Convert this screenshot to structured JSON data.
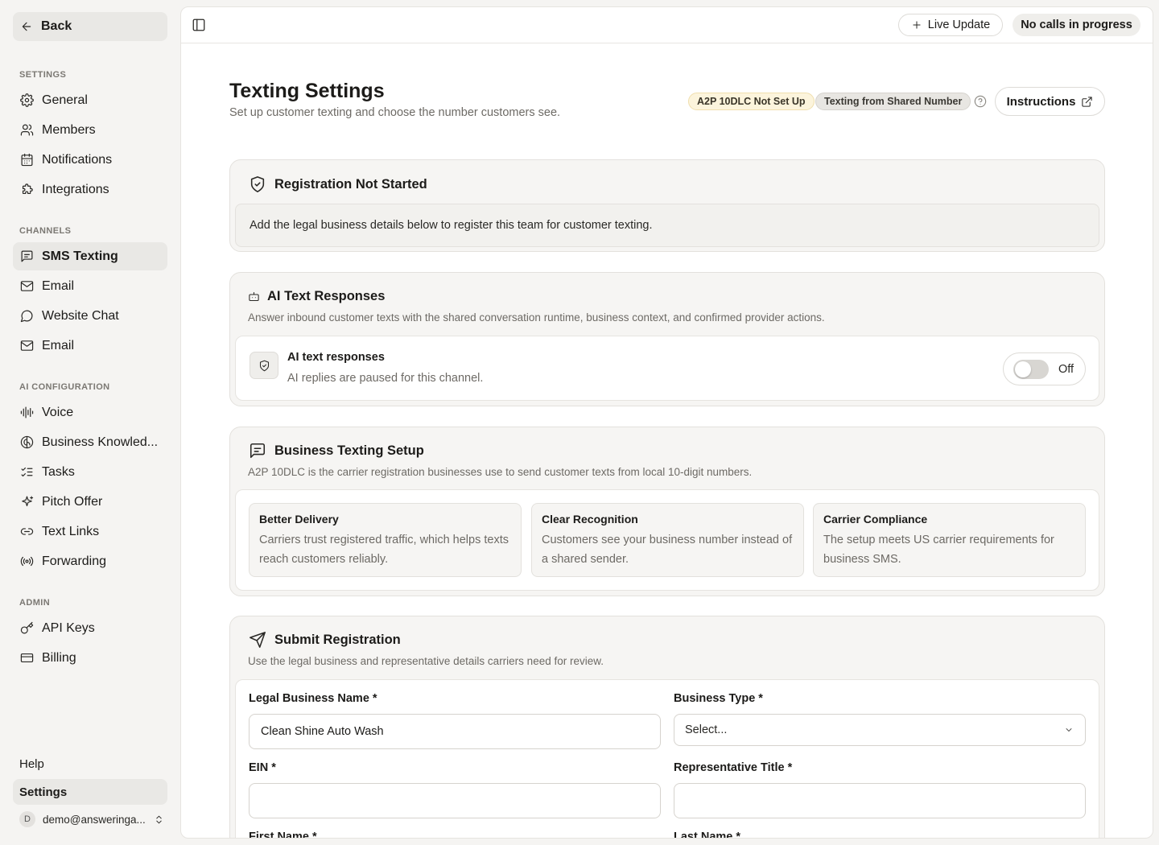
{
  "sidebar": {
    "back_label": "Back",
    "sections": {
      "settings": "SETTINGS",
      "channels": "CHANNELS",
      "ai_config": "AI CONFIGURATION",
      "admin": "ADMIN"
    },
    "settings_items": [
      "General",
      "Members",
      "Notifications",
      "Integrations"
    ],
    "channel_items": [
      "SMS Texting",
      "Email",
      "Website Chat",
      "Email"
    ],
    "ai_items": [
      "Voice",
      "Business Knowled...",
      "Tasks",
      "Pitch Offer",
      "Text Links",
      "Forwarding"
    ],
    "admin_items": [
      "API Keys",
      "Billing"
    ],
    "help_label": "Help",
    "settings_label": "Settings",
    "user_initial": "D",
    "user_email": "demo@answeringa..."
  },
  "topbar": {
    "live_update_label": "Live Update",
    "calls_status": "No calls in progress"
  },
  "header": {
    "title": "Texting Settings",
    "subtitle": "Set up customer texting and choose the number customers see.",
    "badge_a2p": "A2P 10DLC Not Set Up",
    "badge_shared": "Texting from Shared Number",
    "instructions_label": "Instructions"
  },
  "registration": {
    "title": "Registration Not Started",
    "note": "Add the legal business details below to register this team for customer texting."
  },
  "ai_responses": {
    "title": "AI Text Responses",
    "description": "Answer inbound customer texts with the shared conversation runtime, business context, and confirmed provider actions.",
    "row_label": "AI text responses",
    "row_sub": "AI replies are paused for this channel.",
    "toggle_state": "Off",
    "enabled": false
  },
  "texting_setup": {
    "title": "Business Texting Setup",
    "description": "A2P 10DLC is the carrier registration businesses use to send customer texts from local 10-digit numbers.",
    "benefits": [
      {
        "title": "Better Delivery",
        "text": "Carriers trust registered traffic, which helps texts reach customers reliably."
      },
      {
        "title": "Clear Recognition",
        "text": "Customers see your business number instead of a shared sender."
      },
      {
        "title": "Carrier Compliance",
        "text": "The setup meets US carrier requirements for business SMS."
      }
    ]
  },
  "submit": {
    "title": "Submit Registration",
    "description": "Use the legal business and representative details carriers need for review.",
    "legal_name_label": "Legal Business Name *",
    "legal_name_value": "Clean Shine Auto Wash",
    "business_type_label": "Business Type *",
    "business_type_value": "Select...",
    "ein_label": "EIN *",
    "ein_value": "",
    "rep_title_label": "Representative Title *",
    "rep_title_value": "",
    "first_name_label": "First Name *",
    "last_name_label": "Last Name *"
  }
}
